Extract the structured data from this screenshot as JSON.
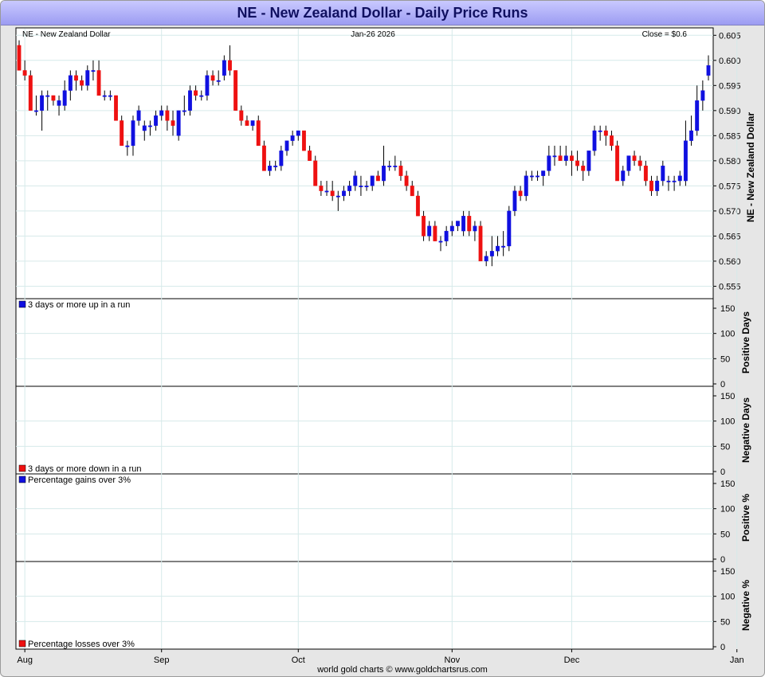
{
  "chart_data": {
    "type": "candlestick",
    "title": "NE - New Zealand Dollar - Daily Price Runs",
    "header": {
      "left": "NE - New Zealand Dollar",
      "center": "Jan-26  2026",
      "right": "Close = $0.6"
    },
    "footer": "world gold charts © www.goldchartsrus.com",
    "colors": {
      "up": "#1010e0",
      "down": "#ee1111",
      "grid": "#d6eaea"
    },
    "price_panel": {
      "ylabel": "NE - New Zealand Dollar",
      "ylim": [
        0.553,
        0.606
      ],
      "ticks": [
        "0.605",
        "0.600",
        "0.595",
        "0.590",
        "0.585",
        "0.580",
        "0.575",
        "0.570",
        "0.565",
        "0.560",
        "0.555"
      ],
      "candles": [
        [
          0.603,
          0.604,
          0.598,
          0.598
        ],
        [
          0.598,
          0.6,
          0.596,
          0.597
        ],
        [
          0.597,
          0.598,
          0.59,
          0.59
        ],
        [
          0.59,
          0.593,
          0.589,
          0.59
        ],
        [
          0.59,
          0.594,
          0.586,
          0.593
        ],
        [
          0.593,
          0.594,
          0.59,
          0.593
        ],
        [
          0.593,
          0.593,
          0.591,
          0.592
        ],
        [
          0.591,
          0.593,
          0.589,
          0.592
        ],
        [
          0.591,
          0.596,
          0.59,
          0.594
        ],
        [
          0.594,
          0.598,
          0.592,
          0.597
        ],
        [
          0.597,
          0.598,
          0.594,
          0.596
        ],
        [
          0.596,
          0.597,
          0.594,
          0.595
        ],
        [
          0.595,
          0.599,
          0.594,
          0.598
        ],
        [
          0.598,
          0.6,
          0.596,
          0.598
        ],
        [
          0.598,
          0.6,
          0.593,
          0.593
        ],
        [
          0.593,
          0.594,
          0.592,
          0.593
        ],
        [
          0.593,
          0.594,
          0.592,
          0.593
        ],
        [
          0.593,
          0.593,
          0.588,
          0.588
        ],
        [
          0.588,
          0.589,
          0.583,
          0.583
        ],
        [
          0.583,
          0.584,
          0.581,
          0.583
        ],
        [
          0.583,
          0.589,
          0.581,
          0.588
        ],
        [
          0.588,
          0.591,
          0.587,
          0.59
        ],
        [
          0.586,
          0.588,
          0.584,
          0.587
        ],
        [
          0.587,
          0.588,
          0.585,
          0.587
        ],
        [
          0.587,
          0.59,
          0.586,
          0.589
        ],
        [
          0.589,
          0.591,
          0.588,
          0.59
        ],
        [
          0.59,
          0.591,
          0.586,
          0.588
        ],
        [
          0.588,
          0.59,
          0.585,
          0.587
        ],
        [
          0.585,
          0.59,
          0.584,
          0.59
        ],
        [
          0.59,
          0.593,
          0.589,
          0.59
        ],
        [
          0.59,
          0.595,
          0.589,
          0.594
        ],
        [
          0.594,
          0.595,
          0.592,
          0.593
        ],
        [
          0.593,
          0.594,
          0.592,
          0.593
        ],
        [
          0.593,
          0.598,
          0.592,
          0.597
        ],
        [
          0.597,
          0.598,
          0.595,
          0.596
        ],
        [
          0.596,
          0.598,
          0.595,
          0.596
        ],
        [
          0.597,
          0.601,
          0.596,
          0.6
        ],
        [
          0.6,
          0.603,
          0.597,
          0.598
        ],
        [
          0.598,
          0.598,
          0.59,
          0.59
        ],
        [
          0.59,
          0.591,
          0.587,
          0.588
        ],
        [
          0.588,
          0.589,
          0.587,
          0.587
        ],
        [
          0.587,
          0.588,
          0.586,
          0.588
        ],
        [
          0.588,
          0.589,
          0.583,
          0.583
        ],
        [
          0.583,
          0.584,
          0.578,
          0.578
        ],
        [
          0.578,
          0.58,
          0.577,
          0.579
        ],
        [
          0.579,
          0.58,
          0.578,
          0.579
        ],
        [
          0.579,
          0.583,
          0.578,
          0.582
        ],
        [
          0.582,
          0.584,
          0.581,
          0.584
        ],
        [
          0.584,
          0.586,
          0.583,
          0.585
        ],
        [
          0.585,
          0.586,
          0.584,
          0.586
        ],
        [
          0.586,
          0.586,
          0.582,
          0.582
        ],
        [
          0.582,
          0.583,
          0.58,
          0.58
        ],
        [
          0.58,
          0.581,
          0.575,
          0.575
        ],
        [
          0.575,
          0.576,
          0.573,
          0.574
        ],
        [
          0.574,
          0.576,
          0.573,
          0.574
        ],
        [
          0.574,
          0.576,
          0.572,
          0.573
        ],
        [
          0.573,
          0.574,
          0.57,
          0.573
        ],
        [
          0.573,
          0.575,
          0.572,
          0.574
        ],
        [
          0.574,
          0.576,
          0.573,
          0.575
        ],
        [
          0.575,
          0.578,
          0.574,
          0.577
        ],
        [
          0.575,
          0.577,
          0.573,
          0.575
        ],
        [
          0.575,
          0.576,
          0.574,
          0.575
        ],
        [
          0.575,
          0.577,
          0.574,
          0.577
        ],
        [
          0.577,
          0.578,
          0.576,
          0.576
        ],
        [
          0.576,
          0.583,
          0.575,
          0.579
        ],
        [
          0.579,
          0.58,
          0.578,
          0.579
        ],
        [
          0.579,
          0.581,
          0.578,
          0.579
        ],
        [
          0.579,
          0.58,
          0.576,
          0.577
        ],
        [
          0.577,
          0.578,
          0.574,
          0.575
        ],
        [
          0.575,
          0.576,
          0.573,
          0.573
        ],
        [
          0.573,
          0.574,
          0.569,
          0.569
        ],
        [
          0.569,
          0.57,
          0.564,
          0.565
        ],
        [
          0.565,
          0.568,
          0.564,
          0.567
        ],
        [
          0.567,
          0.568,
          0.564,
          0.564
        ],
        [
          0.564,
          0.565,
          0.562,
          0.564
        ],
        [
          0.564,
          0.567,
          0.563,
          0.566
        ],
        [
          0.566,
          0.568,
          0.565,
          0.567
        ],
        [
          0.567,
          0.568,
          0.566,
          0.568
        ],
        [
          0.566,
          0.57,
          0.565,
          0.569
        ],
        [
          0.569,
          0.57,
          0.565,
          0.566
        ],
        [
          0.566,
          0.568,
          0.564,
          0.567
        ],
        [
          0.567,
          0.568,
          0.56,
          0.56
        ],
        [
          0.56,
          0.562,
          0.559,
          0.561
        ],
        [
          0.561,
          0.565,
          0.559,
          0.562
        ],
        [
          0.562,
          0.565,
          0.561,
          0.563
        ],
        [
          0.563,
          0.566,
          0.561,
          0.563
        ],
        [
          0.563,
          0.571,
          0.562,
          0.57
        ],
        [
          0.57,
          0.575,
          0.569,
          0.574
        ],
        [
          0.574,
          0.575,
          0.572,
          0.573
        ],
        [
          0.573,
          0.578,
          0.572,
          0.577
        ],
        [
          0.577,
          0.578,
          0.576,
          0.577
        ],
        [
          0.577,
          0.578,
          0.576,
          0.577
        ],
        [
          0.577,
          0.578,
          0.575,
          0.578
        ],
        [
          0.578,
          0.583,
          0.577,
          0.581
        ],
        [
          0.581,
          0.583,
          0.579,
          0.581
        ],
        [
          0.581,
          0.583,
          0.58,
          0.58
        ],
        [
          0.58,
          0.583,
          0.579,
          0.581
        ],
        [
          0.581,
          0.582,
          0.577,
          0.58
        ],
        [
          0.58,
          0.582,
          0.578,
          0.579
        ],
        [
          0.579,
          0.58,
          0.576,
          0.578
        ],
        [
          0.578,
          0.582,
          0.577,
          0.582
        ],
        [
          0.582,
          0.587,
          0.581,
          0.586
        ],
        [
          0.586,
          0.587,
          0.584,
          0.586
        ],
        [
          0.586,
          0.587,
          0.583,
          0.585
        ],
        [
          0.585,
          0.586,
          0.582,
          0.583
        ],
        [
          0.583,
          0.584,
          0.576,
          0.576
        ],
        [
          0.576,
          0.579,
          0.575,
          0.578
        ],
        [
          0.578,
          0.581,
          0.577,
          0.581
        ],
        [
          0.581,
          0.582,
          0.579,
          0.58
        ],
        [
          0.58,
          0.581,
          0.578,
          0.579
        ],
        [
          0.579,
          0.58,
          0.575,
          0.576
        ],
        [
          0.576,
          0.577,
          0.573,
          0.574
        ],
        [
          0.574,
          0.577,
          0.573,
          0.576
        ],
        [
          0.576,
          0.58,
          0.575,
          0.579
        ],
        [
          0.576,
          0.577,
          0.574,
          0.576
        ],
        [
          0.576,
          0.577,
          0.574,
          0.576
        ],
        [
          0.576,
          0.578,
          0.575,
          0.577
        ],
        [
          0.576,
          0.588,
          0.575,
          0.584
        ],
        [
          0.584,
          0.589,
          0.583,
          0.586
        ],
        [
          0.586,
          0.595,
          0.585,
          0.592
        ],
        [
          0.592,
          0.596,
          0.59,
          0.594
        ],
        [
          0.597,
          0.601,
          0.596,
          0.599
        ]
      ]
    },
    "panels": [
      {
        "legend": "3 days or more up in a run",
        "legend_color": "#1010e0",
        "legend_pos": "top",
        "ylabel": "Positive Days",
        "ticks": [
          "150",
          "100",
          "50",
          "0"
        ]
      },
      {
        "legend": "3 days or more down in a run",
        "legend_color": "#ee1111",
        "legend_pos": "bottom",
        "ylabel": "Negative Days",
        "ticks": [
          "150",
          "100",
          "50",
          "0"
        ]
      },
      {
        "legend": "Percentage gains over 3%",
        "legend_color": "#1010e0",
        "legend_pos": "top",
        "ylabel": "Positive %",
        "ticks": [
          "150",
          "100",
          "50",
          "0"
        ]
      },
      {
        "legend": "Percentage losses over 3%",
        "legend_color": "#ee1111",
        "legend_pos": "bottom",
        "ylabel": "Negative %",
        "ticks": [
          "150",
          "100",
          "50",
          "0"
        ]
      }
    ],
    "x_labels": [
      "Aug",
      "Sep",
      "Oct",
      "Nov",
      "Dec",
      "Jan"
    ],
    "x_label_candle_index": [
      1,
      25,
      49,
      76,
      97,
      126
    ]
  }
}
